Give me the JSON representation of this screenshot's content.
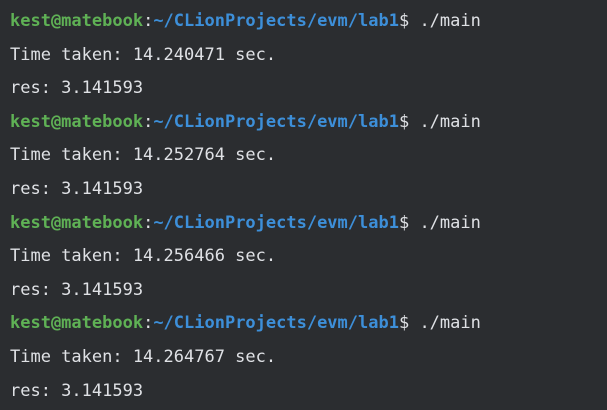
{
  "terminal": {
    "runs": [
      {
        "prompt": {
          "user_host": "kest@matebook",
          "colon": ":",
          "path": "~/CLionProjects/evm/lab1",
          "symbol": "$",
          "command": " ./main"
        },
        "time_line": "Time taken: 14.240471 sec.",
        "res_line": "res: 3.141593"
      },
      {
        "prompt": {
          "user_host": "kest@matebook",
          "colon": ":",
          "path": "~/CLionProjects/evm/lab1",
          "symbol": "$",
          "command": " ./main"
        },
        "time_line": "Time taken: 14.252764 sec.",
        "res_line": "res: 3.141593"
      },
      {
        "prompt": {
          "user_host": "kest@matebook",
          "colon": ":",
          "path": "~/CLionProjects/evm/lab1",
          "symbol": "$",
          "command": " ./main"
        },
        "time_line": "Time taken: 14.256466 sec.",
        "res_line": "res: 3.141593"
      },
      {
        "prompt": {
          "user_host": "kest@matebook",
          "colon": ":",
          "path": "~/CLionProjects/evm/lab1",
          "symbol": "$",
          "command": " ./main"
        },
        "time_line": "Time taken: 14.264767 sec.",
        "res_line": "res: 3.141593"
      }
    ]
  },
  "colors": {
    "background": "#2b2d30",
    "user_host": "#5fb155",
    "path": "#3d8fd9",
    "text": "#dfe1e5"
  }
}
